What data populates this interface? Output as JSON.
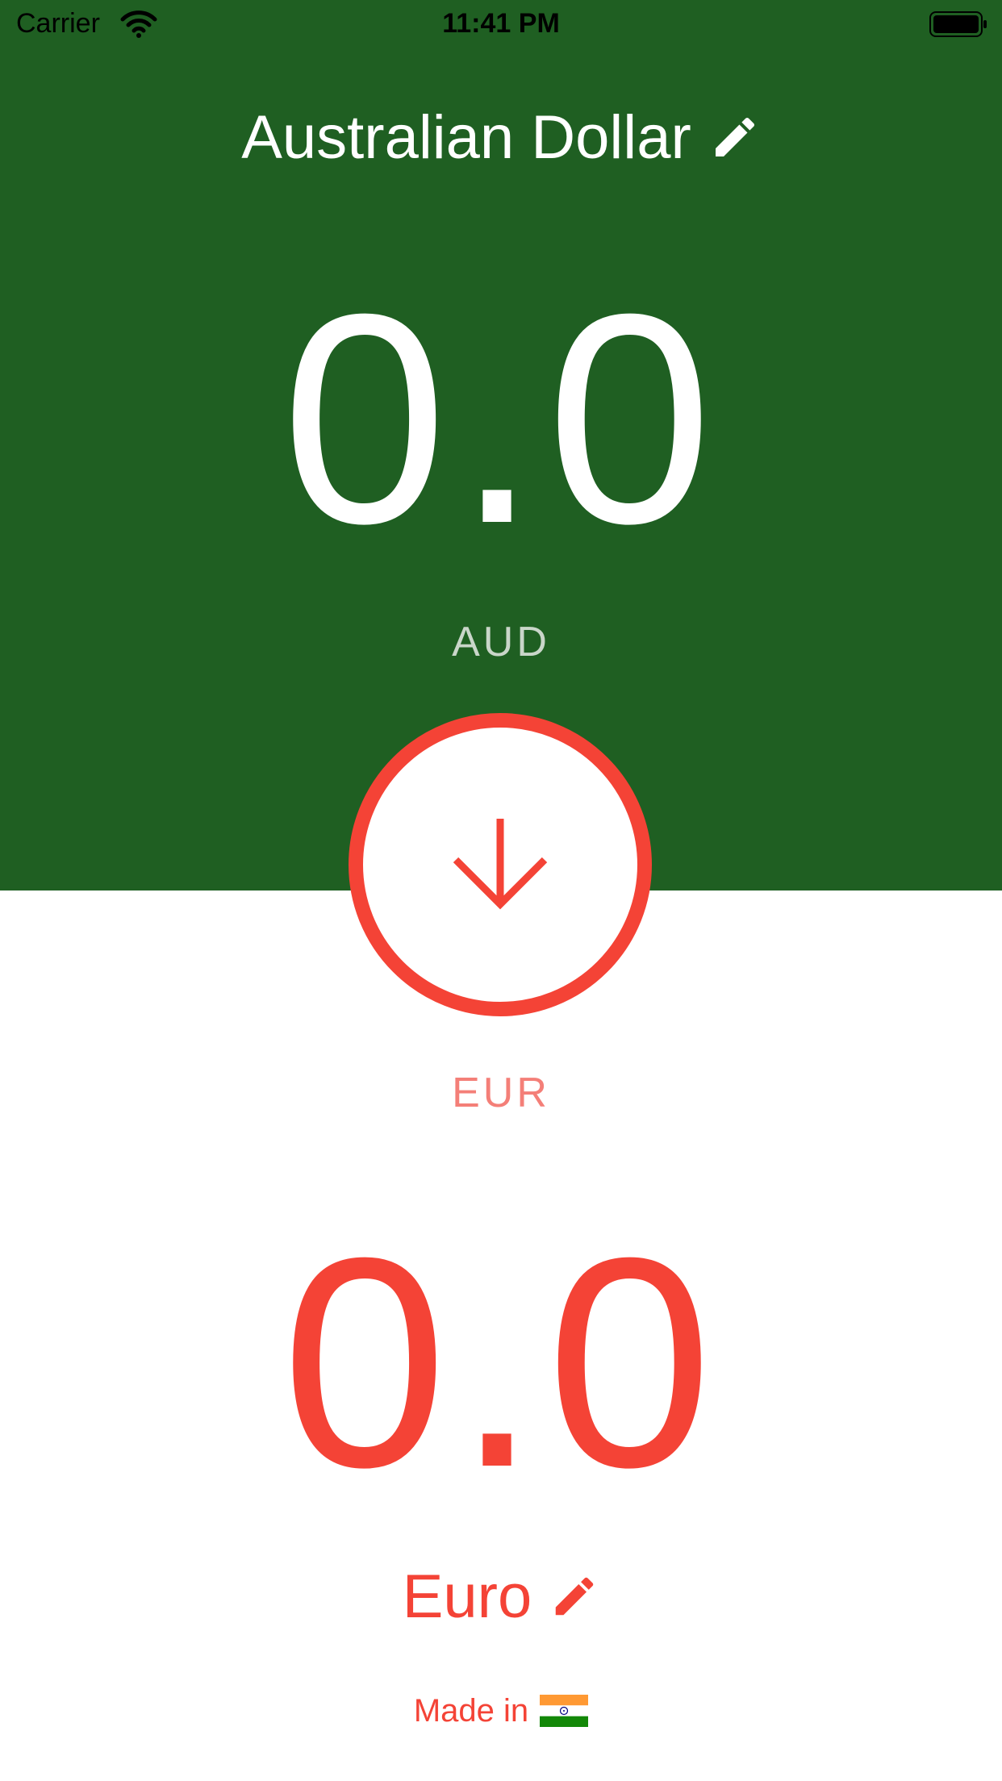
{
  "status_bar": {
    "carrier": "Carrier",
    "time": "11:41 PM"
  },
  "from_currency": {
    "name": "Australian Dollar",
    "amount": "0.0",
    "code": "AUD",
    "background_color": "#1f5f22",
    "text_color": "#ffffff"
  },
  "to_currency": {
    "name": "Euro",
    "amount": "0.0",
    "code": "EUR",
    "accent_color": "#f44336"
  },
  "swap_button": {
    "icon": "arrow-down-icon"
  },
  "footer": {
    "text": "Made in",
    "icon": "india-flag-icon"
  }
}
